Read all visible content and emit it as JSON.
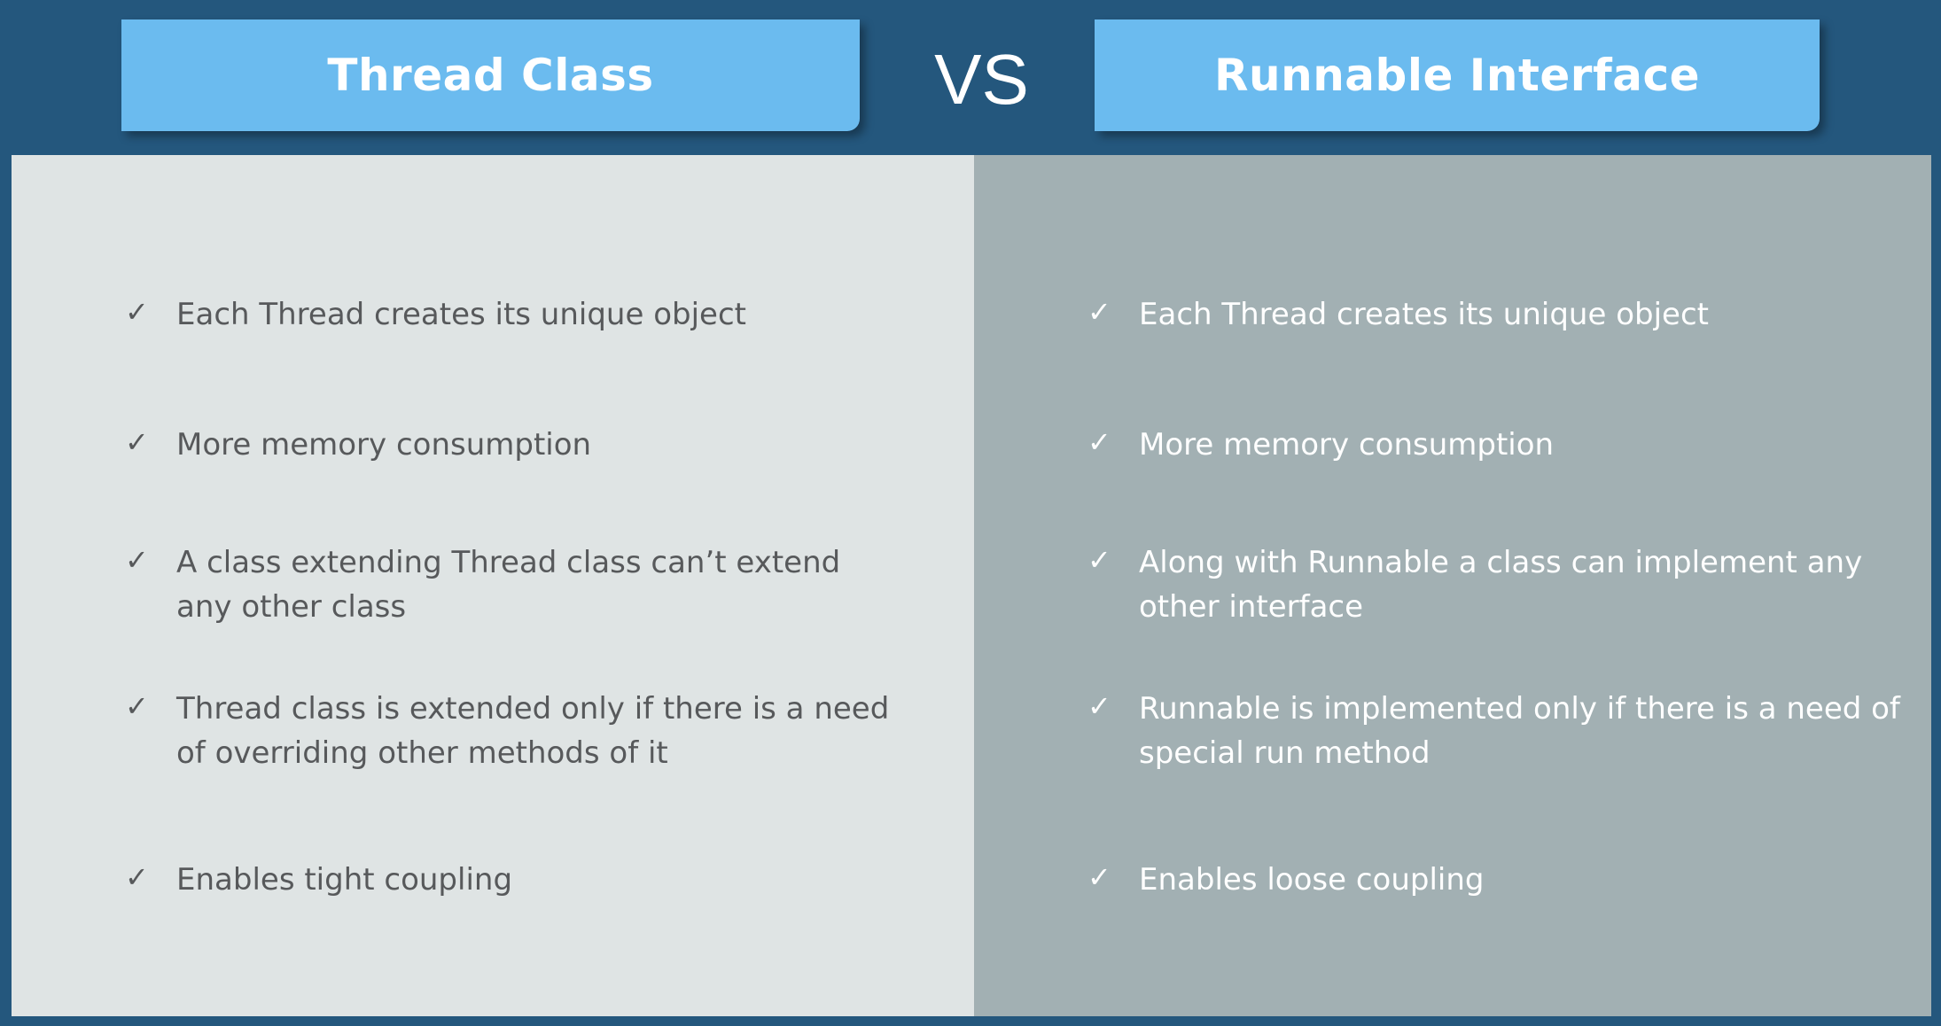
{
  "header": {
    "left_title": "Thread Class",
    "vs": "VS",
    "right_title": "Runnable Interface"
  },
  "thread_class": {
    "items": [
      "Each Thread creates its unique object",
      "More memory consumption",
      "A class extending Thread class can’t extend any other class",
      "Thread class is extended only if there is a need of overriding other methods of it",
      "Enables tight coupling"
    ]
  },
  "runnable_interface": {
    "items": [
      "Each Thread creates its unique object",
      "More memory consumption",
      "Along with Runnable a class can implement any other interface",
      "Runnable is implemented only if there is a need of special run method",
      "Enables loose coupling"
    ]
  },
  "icons": {
    "bullet": "check-mark-icon"
  },
  "colors": {
    "background": "#24577d",
    "header_tab": "#6bbbef",
    "left_panel": "#dfe4e4",
    "right_panel": "#a2b0b3",
    "left_text": "#57595b",
    "right_text": "#ffffff"
  }
}
